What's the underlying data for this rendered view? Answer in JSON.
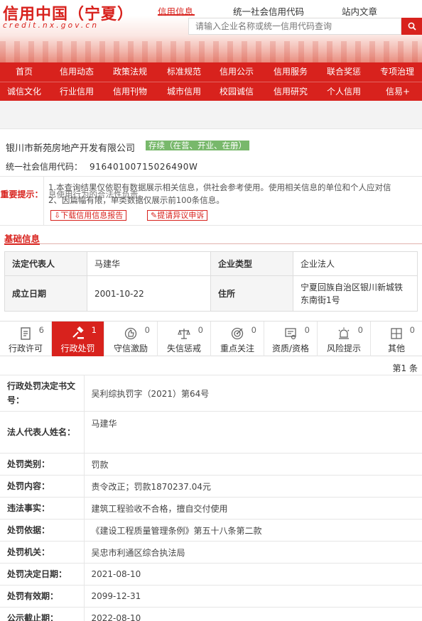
{
  "header": {
    "logo_title": "信用中国（宁夏）",
    "logo_url": "credit.nx.gov.cn",
    "top_links": [
      "信用信息",
      "统一社会信用代码",
      "站内文章"
    ],
    "search_placeholder": "请输入企业名称或统一信用代码查询"
  },
  "nav": {
    "row1": [
      "首页",
      "信用动态",
      "政策法规",
      "标准规范",
      "信用公示",
      "信用服务",
      "联合奖惩",
      "专项治理"
    ],
    "row2": [
      "诚信文化",
      "行业信用",
      "信用刊物",
      "城市信用",
      "校园诚信",
      "信用研究",
      "个人信用",
      "信易+"
    ]
  },
  "company": {
    "name": "银川市新苑房地产开发有限公司",
    "status": "存续（在营、开业、在册）",
    "credit_label": "统一社会信用代码：",
    "credit_code": "91640100715026490W"
  },
  "notice": {
    "label": "重要提示：",
    "line1": "1.本查询结果仅依职有数据展示相关信息，供社会参考使用。使用相关信息的单位和个人应对信",
    "line1b": "息使用行为的合法性负责。",
    "line2": "2、因篇幅有限，单类数据仅展示前100条信息。",
    "btn_report": "⇩下载信用信息报告",
    "btn_appeal": "✎提请异议申诉"
  },
  "basic": {
    "title": "基础信息",
    "legal_rep_label": "法定代表人",
    "legal_rep": "马建华",
    "type_label": "企业类型",
    "type": "企业法人",
    "founded_label": "成立日期",
    "founded": "2001-10-22",
    "address_label": "住所",
    "address": "宁夏回族自治区银川新城铁东南街1号"
  },
  "tabs": [
    {
      "label": "行政许可",
      "count": "6",
      "icon": "document-icon"
    },
    {
      "label": "行政处罚",
      "count": "1",
      "icon": "gavel-icon"
    },
    {
      "label": "守信激励",
      "count": "0",
      "icon": "thumbs-up-icon"
    },
    {
      "label": "失信惩戒",
      "count": "0",
      "icon": "scale-icon"
    },
    {
      "label": "重点关注",
      "count": "0",
      "icon": "target-icon"
    },
    {
      "label": "资质/资格",
      "count": "0",
      "icon": "certificate-icon"
    },
    {
      "label": "风险提示",
      "count": "0",
      "icon": "alarm-icon"
    },
    {
      "label": "其他",
      "count": "0",
      "icon": "grid-icon"
    }
  ],
  "page_count": "第1 条",
  "penalty": [
    {
      "label": "行政处罚决定书文号：",
      "value": "吴利综执罚字（2021）第64号"
    },
    {
      "label": "法人代表人姓名：",
      "value": "马建华"
    },
    {
      "label": "处罚类别：",
      "value": "罚款"
    },
    {
      "label": "处罚内容：",
      "value": "责令改正；罚款1870237.04元"
    },
    {
      "label": "违法事实：",
      "value": "建筑工程验收不合格，擅自交付使用"
    },
    {
      "label": "处罚依据：",
      "value": "《建设工程质量管理条例》第五十八条第二款"
    },
    {
      "label": "处罚机关：",
      "value": "吴忠市利通区综合执法局"
    },
    {
      "label": "处罚决定日期：",
      "value": "2021-08-10"
    },
    {
      "label": "处罚有效期：",
      "value": "2099-12-31"
    },
    {
      "label": "公示截止期：",
      "value": "2022-08-10"
    }
  ],
  "colors": {
    "brand_red": "#d8221d",
    "status_green": "#78b86b"
  }
}
